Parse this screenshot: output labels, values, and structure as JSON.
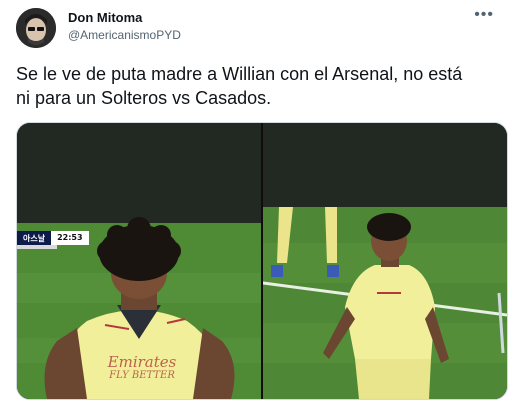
{
  "tweet": {
    "author": {
      "display_name": "Don Mitoma",
      "handle": "@AmericanismoPYD"
    },
    "more_icon": "more-horizontal-icon",
    "text_lines": [
      "Se le ve de puta madre a Willian con el Arsenal, no está",
      "ni para un Solteros vs Casados."
    ],
    "media": {
      "scoreboard": {
        "team": "아스날",
        "time": "22:53"
      },
      "shirt_sponsor": {
        "line1": "Emirates",
        "line2": "FLY BETTER"
      }
    }
  },
  "colors": {
    "name": "#0f1419",
    "secondary": "#536471",
    "border": "#cfd9de",
    "kit_yellow": "#f1ef9a",
    "pitch_green": "#4f8a35"
  }
}
